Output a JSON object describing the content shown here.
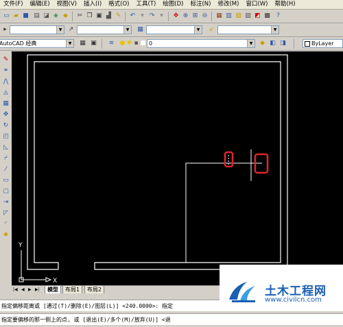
{
  "menu": {
    "items": [
      "文件(F)",
      "编辑(E)",
      "视图(V)",
      "插入(I)",
      "格式(O)",
      "工具(T)",
      "绘图(D)",
      "标注(N)",
      "修改(M)",
      "窗口(W)",
      "帮助(H)"
    ]
  },
  "toolbar": {
    "workspace": "AutoCAD 经典",
    "layer_name": "0",
    "color_value": "ByLayer"
  },
  "layout_tabs": {
    "model": "模型",
    "layout1": "布局1",
    "layout2": "布局2"
  },
  "ucs": {
    "y": "Y",
    "x": "X"
  },
  "command": {
    "line1": "指定偏移距离或 [通过(T)/删除(E)/图层(L)] <240.0000>:  指定",
    "line2": "指定要偏移的那一侧上的点, 或 [退出(E)/多个(M)/放弃(U)] <退"
  },
  "watermark": {
    "title": "土木工程网",
    "url": "www.civilcn.com"
  },
  "colors": {
    "canvas": "#000000",
    "drawing_line": "#ffffff",
    "highlight": "#e0262b",
    "brand": "#1a5fb4"
  }
}
